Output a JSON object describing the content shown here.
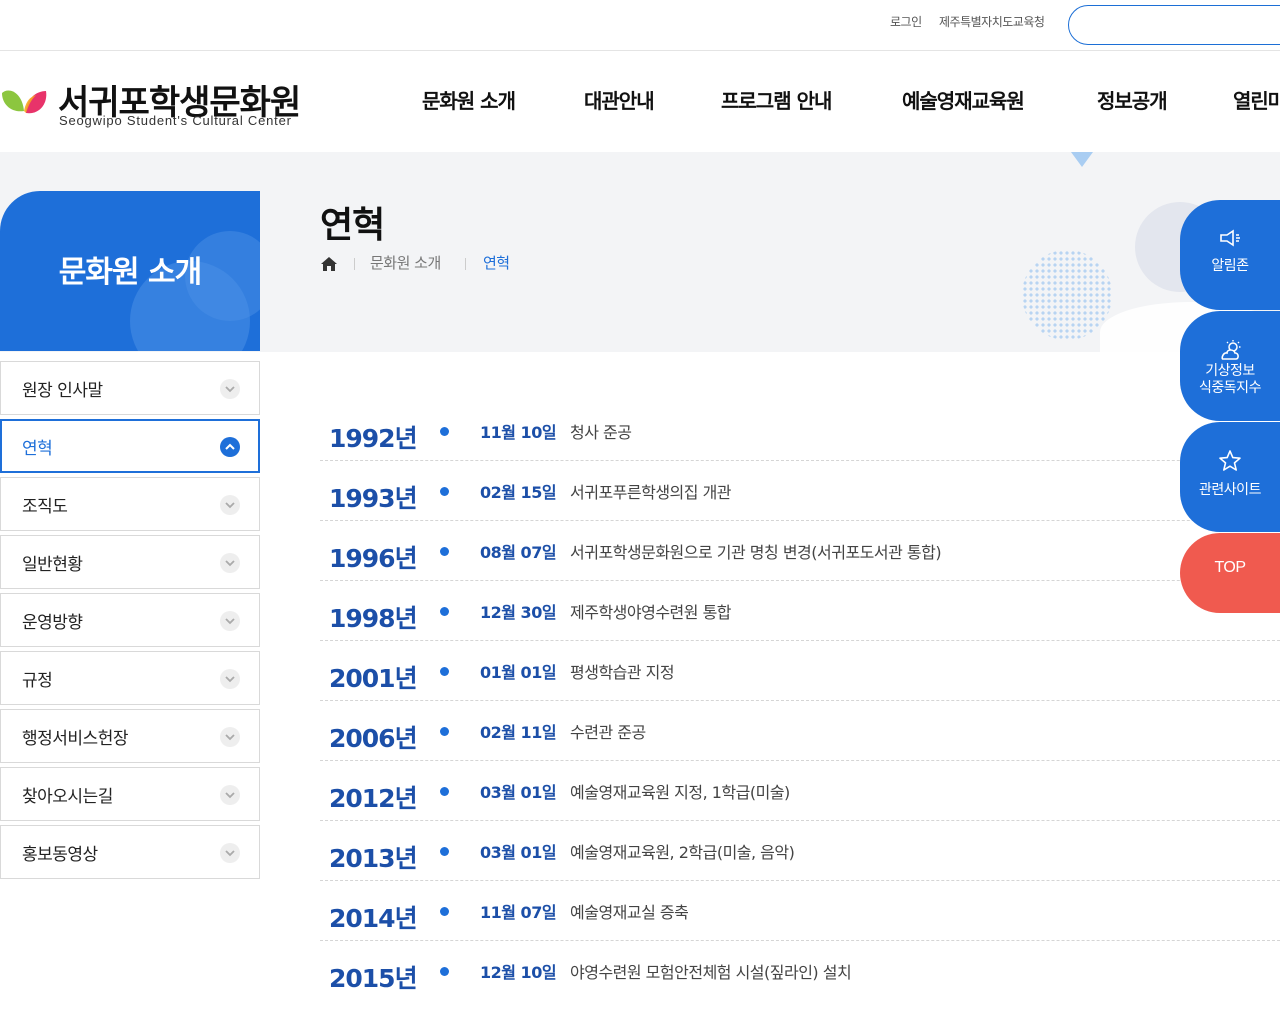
{
  "top_util": {
    "login": "로그인",
    "office": "제주특별자치도교육청",
    "search_placeholder": ""
  },
  "brand": {
    "name_ko": "서귀포학생문화원",
    "name_en": "Seogwipo Student's Cultural Center",
    "leaf_green": "#8cc63f",
    "leaf_red": "#e8336a"
  },
  "gnb": [
    "문화원 소개",
    "대관안내",
    "프로그램 안내",
    "예술영재교육원",
    "정보공개",
    "열린마당"
  ],
  "lnb": {
    "title": "문화원 소개",
    "items": [
      "원장 인사말",
      "연혁",
      "조직도",
      "일반현황",
      "운영방향",
      "규정",
      "행정서비스헌장",
      "찾아오시는길",
      "홍보동영상"
    ],
    "active": "연혁"
  },
  "page": {
    "title": "연혁",
    "breadcrumb": [
      "문화원 소개",
      "연혁"
    ]
  },
  "history": [
    {
      "year": "1992년",
      "date": "11월 10일",
      "event": "청사 준공"
    },
    {
      "year": "1993년",
      "date": "02월 15일",
      "event": "서귀포푸른학생의집 개관"
    },
    {
      "year": "1996년",
      "date": "08월 07일",
      "event": "서귀포학생문화원으로 기관 명칭 변경(서귀포도서관 통합)"
    },
    {
      "year": "1998년",
      "date": "12월 30일",
      "event": "제주학생야영수련원 통합"
    },
    {
      "year": "2001년",
      "date": "01월 01일",
      "event": "평생학습관 지정"
    },
    {
      "year": "2006년",
      "date": "02월 11일",
      "event": "수련관 준공"
    },
    {
      "year": "2012년",
      "date": "03월 01일",
      "event": "예술영재교육원 지정, 1학급(미술)"
    },
    {
      "year": "2013년",
      "date": "03월 01일",
      "event": "예술영재교육원, 2학급(미술, 음악)"
    },
    {
      "year": "2014년",
      "date": "11월 07일",
      "event": "예술영재교실 증축"
    },
    {
      "year": "2015년",
      "date": "12월 10일",
      "event": "야영수련원 모험안전체험 시설(짚라인) 설치"
    }
  ],
  "quick": {
    "notice": "알림존",
    "weather": [
      "기상정보",
      "식중독지수"
    ],
    "sites": "관련사이트",
    "top": "TOP"
  },
  "colors": {
    "primary": "#1e6fd9",
    "year_text": "#1c4fa8",
    "top_button": "#f05a4f"
  }
}
